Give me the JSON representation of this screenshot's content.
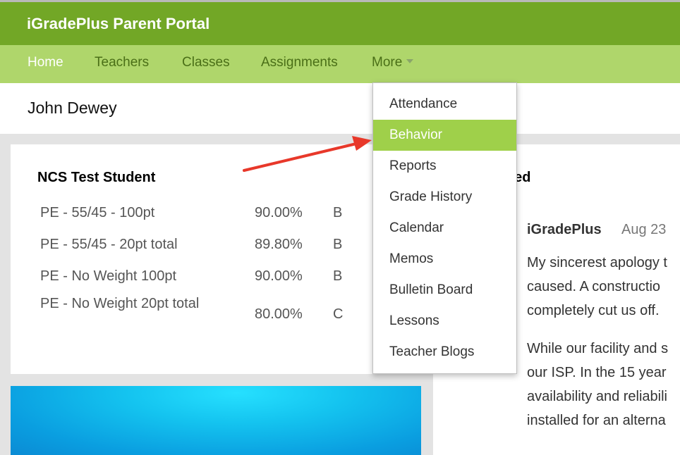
{
  "header": {
    "title": "iGradePlus Parent Portal"
  },
  "nav": {
    "home": "Home",
    "teachers": "Teachers",
    "classes": "Classes",
    "assignments": "Assignments",
    "more": "More"
  },
  "student": {
    "name": "John Dewey"
  },
  "grades": {
    "title": "NCS Test Student",
    "rows": [
      {
        "class": "PE - 55/45 - 100pt",
        "percent": "90.00%",
        "letter": "B"
      },
      {
        "class": "PE - 55/45 - 20pt total",
        "percent": "89.80%",
        "letter": "B"
      },
      {
        "class": "PE - No Weight 100pt",
        "percent": "90.00%",
        "letter": "B"
      },
      {
        "class": "PE - No Weight 20pt total",
        "percent": "80.00%",
        "letter": "C"
      }
    ]
  },
  "feed": {
    "title_partial": "eed",
    "post": {
      "author": "iGradePlus",
      "date": "Aug 23",
      "lines": [
        "My sincerest apology t",
        "caused. A constructio",
        "completely cut us off.",
        "While our facility and s",
        "our ISP. In the 15 year",
        "availability and reliabili",
        "installed for an alterna"
      ]
    }
  },
  "more_menu": {
    "items": [
      "Attendance",
      "Behavior",
      "Reports",
      "Grade History",
      "Calendar",
      "Memos",
      "Bulletin Board",
      "Lessons",
      "Teacher Blogs"
    ],
    "highlighted": "Behavior"
  },
  "colors": {
    "header_bg": "#72a726",
    "nav_bg": "#afd66b",
    "highlight": "#9fd04a",
    "arrow": "#e8382a"
  }
}
